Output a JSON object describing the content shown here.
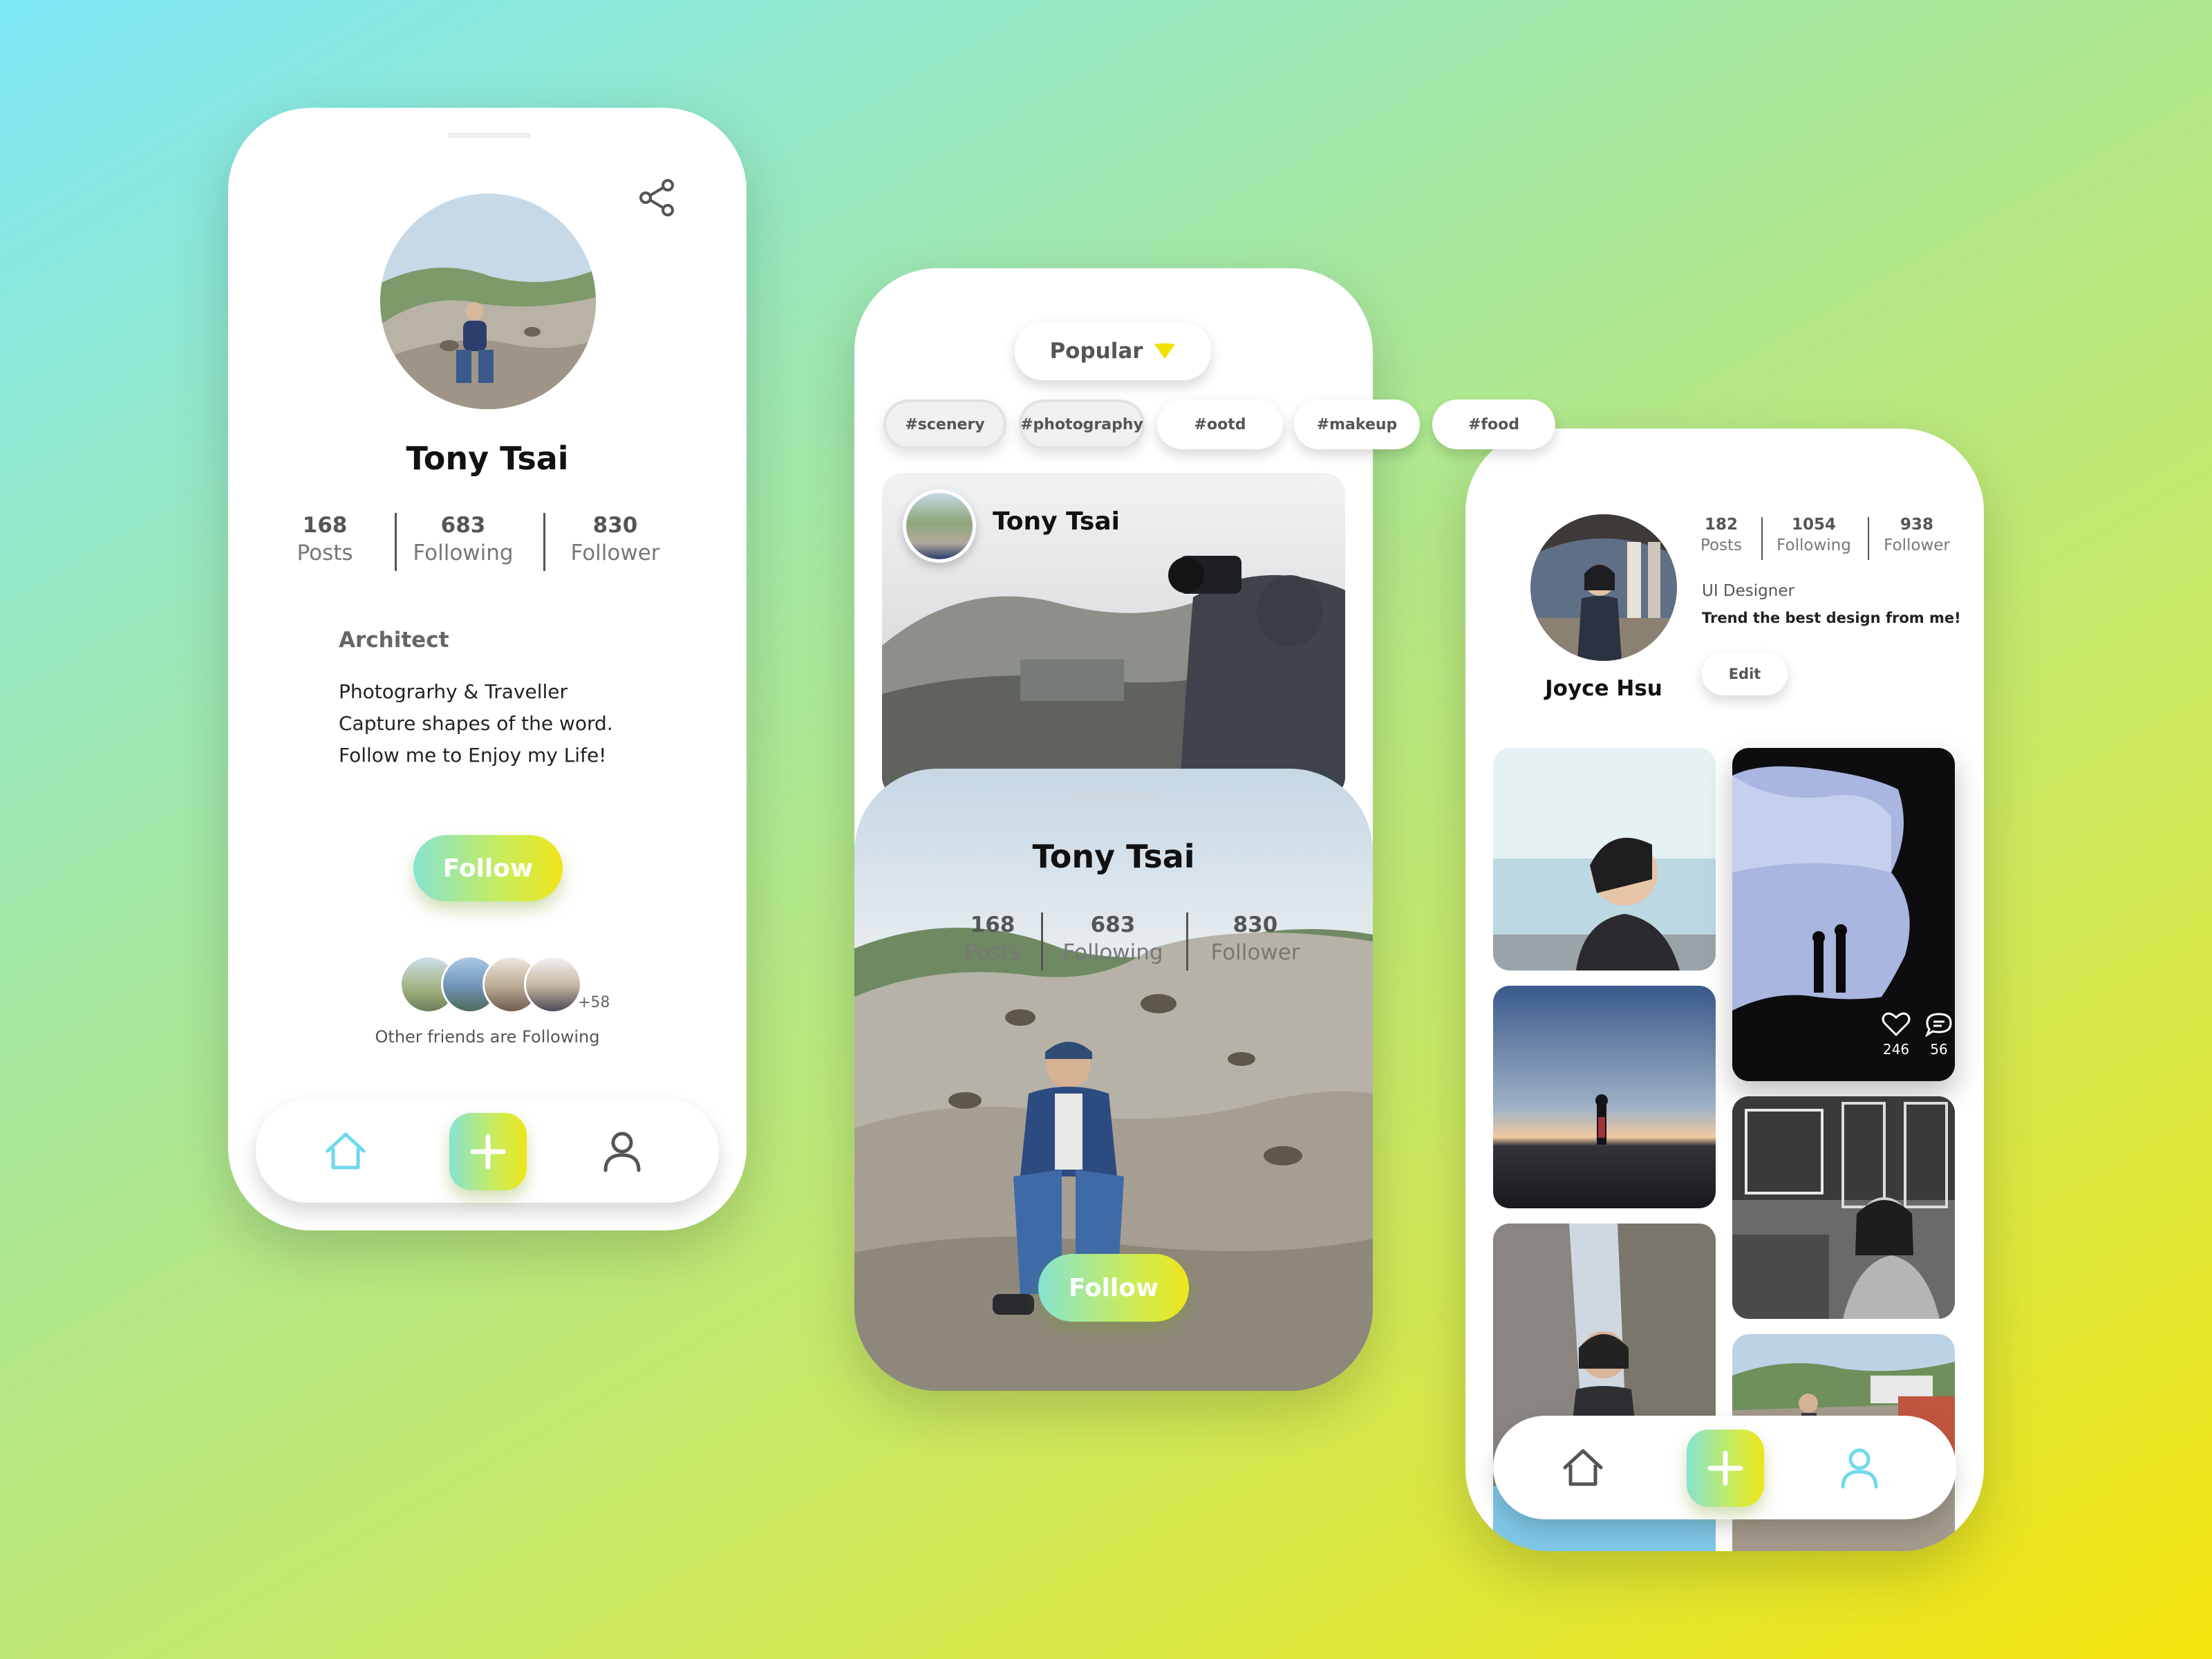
{
  "colors": {
    "accent_cyan": "#7fe3f0",
    "accent_green": "#bfe958",
    "accent_yellow": "#f2e314",
    "nav_active": "#6fd9ee",
    "nav_inactive": "#555555"
  },
  "screen1": {
    "profile": {
      "name": "Tony Tsai",
      "stats": [
        {
          "value": "168",
          "label": "Posts"
        },
        {
          "value": "683",
          "label": "Following"
        },
        {
          "value": "830",
          "label": "Follower"
        }
      ],
      "title": "Architect",
      "bio": [
        "Photograrhy & Traveller",
        "Capture shapes of the word.",
        "Follow me to Enjoy my Life!"
      ]
    },
    "follow_label": "Follow",
    "friends_more": "+58",
    "friends_caption": "Other friends are Following",
    "icons": {
      "share": "share-icon",
      "home": "home-icon",
      "add": "plus-icon",
      "profile": "user-icon"
    }
  },
  "screen2": {
    "sort_label": "Popular",
    "tags": [
      "#scenery",
      "#photography",
      "#ootd",
      "#makeup",
      "#food"
    ],
    "post_author": "Tony Tsai",
    "card": {
      "name": "Tony Tsai",
      "stats": [
        {
          "value": "168",
          "label": "Posts"
        },
        {
          "value": "683",
          "label": "Following"
        },
        {
          "value": "830",
          "label": "Follower"
        }
      ],
      "follow_label": "Follow"
    }
  },
  "screen3": {
    "profile": {
      "name": "Joyce Hsu",
      "stats": [
        {
          "value": "182",
          "label": "Posts"
        },
        {
          "value": "1054",
          "label": "Following"
        },
        {
          "value": "938",
          "label": "Follower"
        }
      ],
      "title": "UI Designer",
      "bio": "Trend the best design from me!",
      "edit_label": "Edit"
    },
    "featured_post": {
      "likes": "246",
      "comments": "56"
    },
    "icons": {
      "home": "home-icon",
      "add": "plus-icon",
      "profile": "user-icon"
    }
  }
}
